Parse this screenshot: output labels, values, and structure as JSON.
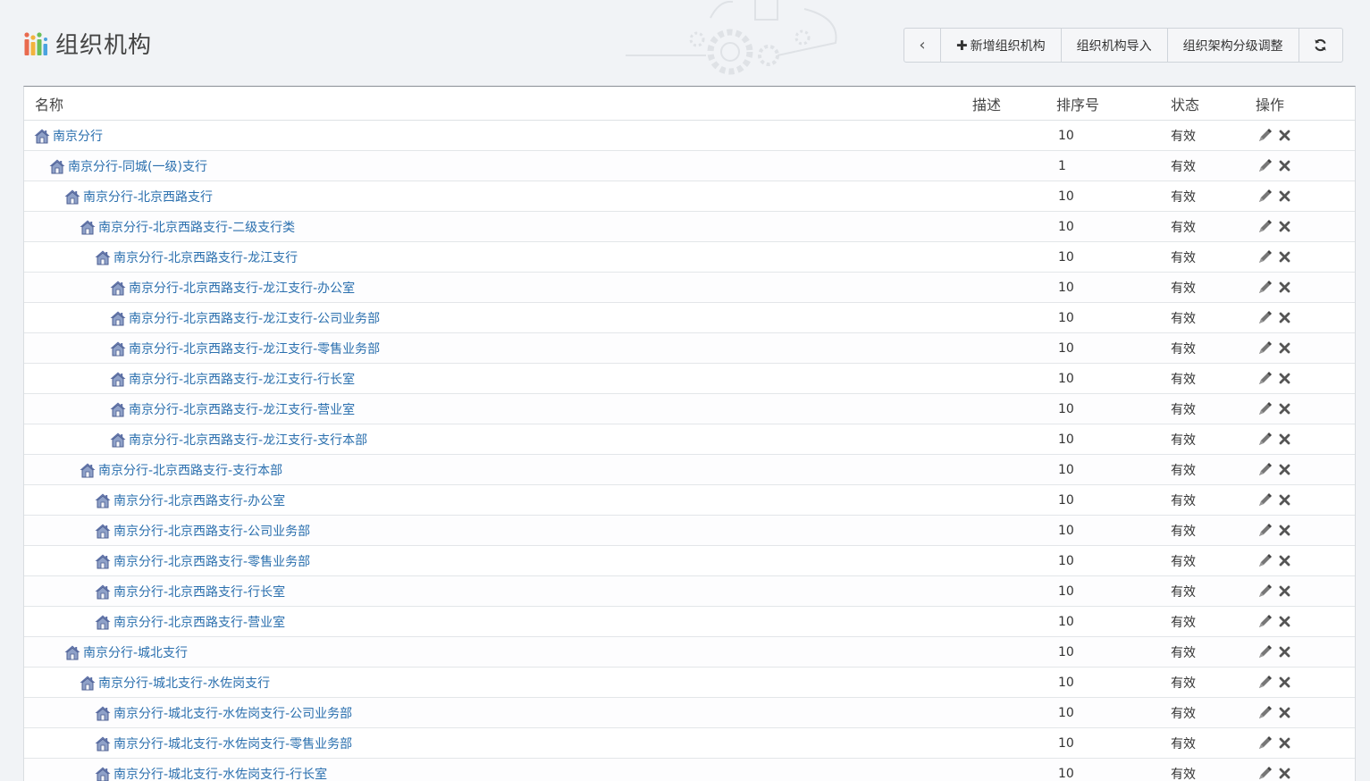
{
  "page": {
    "title": "组织机构"
  },
  "toolbar": {
    "back_label": "‹",
    "add_label": "新增组织机构",
    "import_label": "组织机构导入",
    "adjust_label": "组织架构分级调整"
  },
  "colors": {
    "link": "#2a6fae",
    "house_roof": "#5b6fa6",
    "bars": [
      "#e96a4e",
      "#f2b33d",
      "#6bbf59",
      "#4aa3df"
    ]
  },
  "table": {
    "columns": {
      "name": "名称",
      "desc": "描述",
      "order": "排序号",
      "status": "状态",
      "ops": "操作"
    },
    "rows": [
      {
        "level": 0,
        "name": "南京分行",
        "desc": "",
        "order": "10",
        "status": "有效"
      },
      {
        "level": 1,
        "name": "南京分行-同城(一级)支行",
        "desc": "",
        "order": "1",
        "status": "有效"
      },
      {
        "level": 2,
        "name": "南京分行-北京西路支行",
        "desc": "",
        "order": "10",
        "status": "有效"
      },
      {
        "level": 3,
        "name": "南京分行-北京西路支行-二级支行类",
        "desc": "",
        "order": "10",
        "status": "有效"
      },
      {
        "level": 4,
        "name": "南京分行-北京西路支行-龙江支行",
        "desc": "",
        "order": "10",
        "status": "有效"
      },
      {
        "level": 5,
        "name": "南京分行-北京西路支行-龙江支行-办公室",
        "desc": "",
        "order": "10",
        "status": "有效"
      },
      {
        "level": 5,
        "name": "南京分行-北京西路支行-龙江支行-公司业务部",
        "desc": "",
        "order": "10",
        "status": "有效"
      },
      {
        "level": 5,
        "name": "南京分行-北京西路支行-龙江支行-零售业务部",
        "desc": "",
        "order": "10",
        "status": "有效"
      },
      {
        "level": 5,
        "name": "南京分行-北京西路支行-龙江支行-行长室",
        "desc": "",
        "order": "10",
        "status": "有效"
      },
      {
        "level": 5,
        "name": "南京分行-北京西路支行-龙江支行-营业室",
        "desc": "",
        "order": "10",
        "status": "有效"
      },
      {
        "level": 5,
        "name": "南京分行-北京西路支行-龙江支行-支行本部",
        "desc": "",
        "order": "10",
        "status": "有效"
      },
      {
        "level": 3,
        "name": "南京分行-北京西路支行-支行本部",
        "desc": "",
        "order": "10",
        "status": "有效"
      },
      {
        "level": 4,
        "name": "南京分行-北京西路支行-办公室",
        "desc": "",
        "order": "10",
        "status": "有效"
      },
      {
        "level": 4,
        "name": "南京分行-北京西路支行-公司业务部",
        "desc": "",
        "order": "10",
        "status": "有效"
      },
      {
        "level": 4,
        "name": "南京分行-北京西路支行-零售业务部",
        "desc": "",
        "order": "10",
        "status": "有效"
      },
      {
        "level": 4,
        "name": "南京分行-北京西路支行-行长室",
        "desc": "",
        "order": "10",
        "status": "有效"
      },
      {
        "level": 4,
        "name": "南京分行-北京西路支行-营业室",
        "desc": "",
        "order": "10",
        "status": "有效"
      },
      {
        "level": 2,
        "name": "南京分行-城北支行",
        "desc": "",
        "order": "10",
        "status": "有效"
      },
      {
        "level": 3,
        "name": "南京分行-城北支行-水佐岗支行",
        "desc": "",
        "order": "10",
        "status": "有效"
      },
      {
        "level": 4,
        "name": "南京分行-城北支行-水佐岗支行-公司业务部",
        "desc": "",
        "order": "10",
        "status": "有效"
      },
      {
        "level": 4,
        "name": "南京分行-城北支行-水佐岗支行-零售业务部",
        "desc": "",
        "order": "10",
        "status": "有效"
      },
      {
        "level": 4,
        "name": "南京分行-城北支行-水佐岗支行-行长室",
        "desc": "",
        "order": "10",
        "status": "有效"
      }
    ]
  }
}
